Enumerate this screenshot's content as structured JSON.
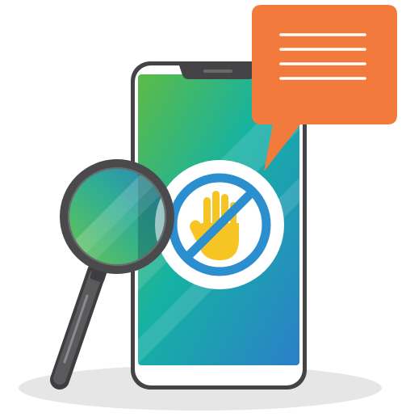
{
  "illustration": {
    "icons": {
      "phone": "smartphone-icon",
      "speech_bubble": "speech-bubble-icon",
      "magnifier": "magnifying-glass-icon",
      "block": "no-hand-block-icon"
    },
    "colors": {
      "phone_frame": "#444345",
      "screen_gradient_start": "#5dbb46",
      "screen_gradient_mid": "#15b2a3",
      "screen_gradient_end": "#2b7fc9",
      "bubble": "#f27a3c",
      "bubble_lines": "#ffffff",
      "block_ring": "#2b8fcf",
      "hand": "#f6c523",
      "shadow": "#e6e6e6"
    }
  }
}
